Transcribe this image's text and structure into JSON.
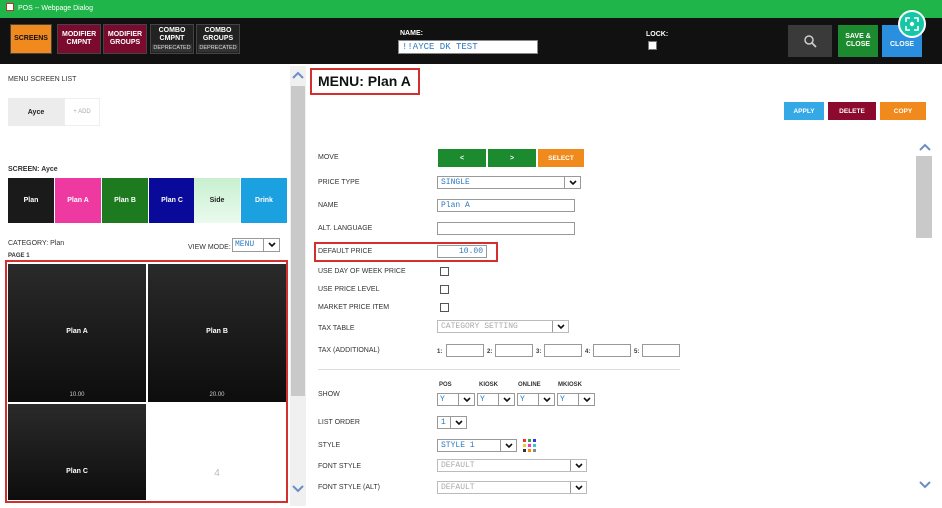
{
  "window": {
    "title": "POS -- Webpage Dialog"
  },
  "topbar": {
    "buttons": [
      {
        "label": "SCREENS",
        "sub": ""
      },
      {
        "label": "MODIFIER CMPNT",
        "sub": ""
      },
      {
        "label": "MODIFIER GROUPS",
        "sub": ""
      },
      {
        "label": "COMBO CMPNT",
        "sub": "DEPRECATED"
      },
      {
        "label": "COMBO GROUPS",
        "sub": "DEPRECATED"
      }
    ],
    "name_label": "NAME:",
    "name_value": "!!AYCE DK TEST",
    "lock_label": "LOCK:",
    "save_label": "SAVE & CLOSE",
    "close_label": "CLOSE"
  },
  "left": {
    "menu_screen_list_label": "MENU SCREEN LIST",
    "tabs": {
      "ayce": "Ayce",
      "add": "+ ADD"
    },
    "screen_label": "SCREEN: Ayce",
    "categories": [
      {
        "label": "Plan",
        "color": "#1a1a1a"
      },
      {
        "label": "Plan A",
        "color": "#ee3aa0"
      },
      {
        "label": "Plan B",
        "color": "#1d7a1f"
      },
      {
        "label": "Plan C",
        "color": "#0a0a9a"
      },
      {
        "label": "Side",
        "color": "#c8f0d0"
      },
      {
        "label": "Drink",
        "color": "#1ba0e0"
      }
    ],
    "category_label": "CATEGORY: Plan",
    "view_mode_label": "VIEW MODE:",
    "view_mode_value": "MENU",
    "page_label": "PAGE 1",
    "items": [
      {
        "name": "Plan A",
        "price": "10.00"
      },
      {
        "name": "Plan B",
        "price": "20.00"
      },
      {
        "name": "Plan C",
        "price": ""
      },
      {
        "name": "4",
        "price": ""
      }
    ]
  },
  "detail": {
    "title": "MENU: Plan A",
    "actions": {
      "apply": "APPLY",
      "delete": "DELETE",
      "copy": "COPY"
    },
    "move_label": "MOVE",
    "move_prev": "<",
    "move_next": ">",
    "move_select": "SELECT",
    "price_type_label": "PRICE TYPE",
    "price_type_value": "SINGLE",
    "name_label": "NAME",
    "name_value": "Plan A",
    "alt_language_label": "ALT. LANGUAGE",
    "alt_language_value": "",
    "default_price_label": "DEFAULT PRICE",
    "default_price_value": "10.00",
    "use_dow_price_label": "USE DAY OF WEEK PRICE",
    "use_price_level_label": "USE PRICE LEVEL",
    "market_price_label": "MARKET PRICE ITEM",
    "tax_table_label": "TAX TABLE",
    "tax_table_value": "CATEGORY SETTING",
    "tax_additional_label": "TAX (ADDITIONAL)",
    "tax_slots": [
      "1:",
      "2:",
      "3:",
      "4:",
      "5:"
    ],
    "show_label": "SHOW",
    "show_columns": [
      {
        "label": "POS",
        "value": "Y"
      },
      {
        "label": "KIOSK",
        "value": "Y"
      },
      {
        "label": "ONLINE",
        "value": "Y"
      },
      {
        "label": "MKIOSK",
        "value": "Y"
      }
    ],
    "list_order_label": "LIST ORDER",
    "list_order_value": "1",
    "style_label": "STYLE",
    "style_value": "STYLE 1",
    "font_style_label": "FONT STYLE",
    "font_style_value": "DEFAULT",
    "font_style_alt_label": "FONT STYLE (ALT)",
    "font_style_alt_value": "DEFAULT"
  }
}
